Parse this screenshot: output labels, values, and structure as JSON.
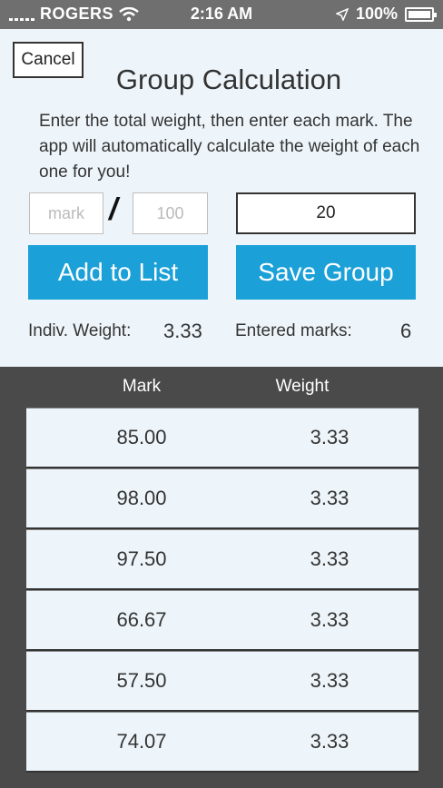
{
  "status_bar": {
    "carrier": "ROGERS",
    "time": "2:16 AM",
    "battery": "100%",
    "battery_level": 1.0
  },
  "header": {
    "cancel_label": "Cancel",
    "title": "Group Calculation",
    "instructions": "Enter the total weight, then enter each mark. The app will automatically calculate the weight of each one for you!"
  },
  "form": {
    "mark_placeholder": "mark",
    "slash": "/",
    "outof_placeholder": "100",
    "weight_value": "20",
    "add_label": "Add to List",
    "save_label": "Save Group"
  },
  "stats": {
    "indiv_weight_label": "Indiv. Weight:",
    "indiv_weight_value": "3.33",
    "entered_marks_label": "Entered marks:",
    "entered_marks_value": "6"
  },
  "table": {
    "headers": [
      "Mark",
      "Weight"
    ],
    "rows": [
      {
        "mark": "85.00",
        "weight": "3.33"
      },
      {
        "mark": "98.00",
        "weight": "3.33"
      },
      {
        "mark": "97.50",
        "weight": "3.33"
      },
      {
        "mark": "66.67",
        "weight": "3.33"
      },
      {
        "mark": "57.50",
        "weight": "3.33"
      },
      {
        "mark": "74.07",
        "weight": "3.33"
      }
    ]
  },
  "colors": {
    "accent": "#1ba0d8",
    "panel": "#eef5fa",
    "background": "#4a4a4a"
  }
}
